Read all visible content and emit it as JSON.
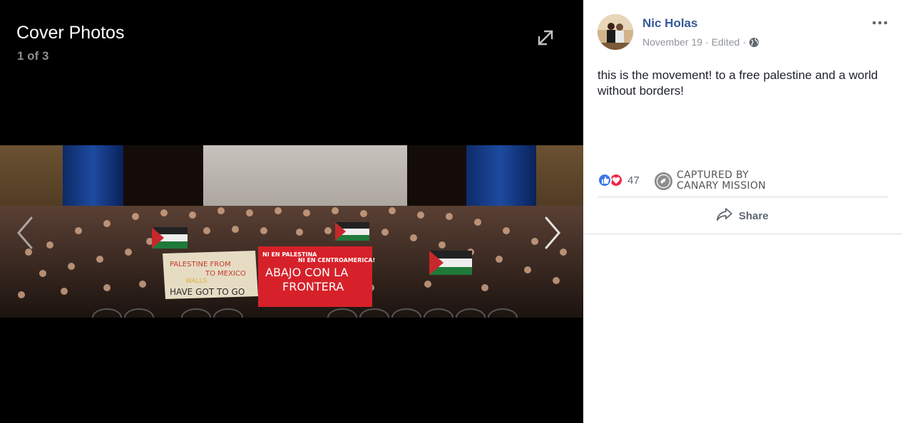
{
  "viewer": {
    "album_title": "Cover Photos",
    "counter": "1 of 3",
    "photo": {
      "description_icon": "group-photo",
      "banner_left_lines": [
        "PALESTINE FROM",
        "TO MEXICO",
        "WALLS",
        "HAVE GOT TO GO"
      ],
      "banner_right_lines": [
        "NI EN PALESTINA",
        "NI EN CENTROAMERICA!",
        "ABAJO CON LA",
        "FRONTERA"
      ]
    }
  },
  "post": {
    "author": "Nic Holas",
    "date": "November 19",
    "edited": "Edited",
    "separator": "·",
    "text": "this is the movement! to a free palestine and a world without borders!",
    "reaction_count": "47",
    "captured_line1": "CAPTURED BY",
    "captured_line2": "CANARY MISSION",
    "share_label": "Share"
  },
  "colors": {
    "viewer_bg": "#000000",
    "author_link": "#365899",
    "meta_gray": "#90949c",
    "like_blue": "#3b78e7",
    "love_red": "#f0284a"
  }
}
